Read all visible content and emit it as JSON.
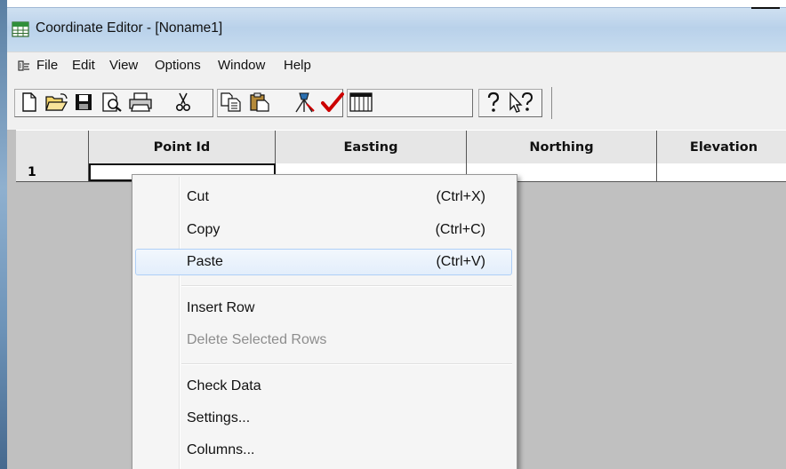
{
  "window": {
    "title": "Coordinate Editor - [Noname1]"
  },
  "menubar": {
    "items": [
      "File",
      "Edit",
      "View",
      "Options",
      "Window",
      "Help"
    ]
  },
  "toolbar": {
    "buttons": [
      "new-icon",
      "open-icon",
      "save-icon",
      "print-preview-icon",
      "print-icon",
      "cut-icon",
      "copy-icon",
      "paste-icon",
      "survey-tool-icon",
      "check-data-icon",
      "columns-grid-icon",
      "help-icon",
      "context-help-icon"
    ]
  },
  "grid": {
    "columns": [
      "Point Id",
      "Easting",
      "Northing",
      "Elevation"
    ],
    "rows": [
      {
        "num": "1",
        "point_id": "",
        "easting": "",
        "northing": "",
        "elevation": ""
      }
    ]
  },
  "context_menu": {
    "items": [
      {
        "label": "Cut",
        "shortcut": "(Ctrl+X)",
        "enabled": true,
        "highlighted": false
      },
      {
        "label": "Copy",
        "shortcut": "(Ctrl+C)",
        "enabled": true,
        "highlighted": false
      },
      {
        "label": "Paste",
        "shortcut": "(Ctrl+V)",
        "enabled": true,
        "highlighted": true
      },
      {
        "label": "Insert Row",
        "shortcut": "",
        "enabled": true,
        "highlighted": false
      },
      {
        "label": "Delete Selected Rows",
        "shortcut": "",
        "enabled": false,
        "highlighted": false
      },
      {
        "label": "Check Data",
        "shortcut": "",
        "enabled": true,
        "highlighted": false
      },
      {
        "label": "Settings...",
        "shortcut": "",
        "enabled": true,
        "highlighted": false
      },
      {
        "label": "Columns...",
        "shortcut": "",
        "enabled": true,
        "highlighted": false
      }
    ]
  },
  "colors": {
    "grid_background": "#c0c0c0",
    "menu_highlight_border": "#aecff7",
    "check_red": "#cc0000"
  }
}
